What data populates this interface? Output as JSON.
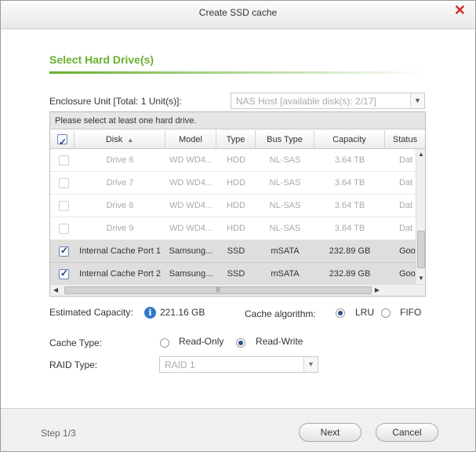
{
  "dialog": {
    "title": "Create SSD cache",
    "close_glyph": "✕"
  },
  "section": {
    "title": "Select Hard Drive(s)"
  },
  "enclosure": {
    "label": "Enclosure Unit [Total: 1 Unit(s)]:",
    "selected": "NAS Host [available disk(s): 2/17]"
  },
  "grid": {
    "info": "Please select at least one hard drive.",
    "columns": [
      "Disk",
      "Model",
      "Type",
      "Bus Type",
      "Capacity",
      "Status"
    ],
    "sort_indicator": "▲",
    "rows": [
      {
        "disk": "Drive 6",
        "model": "WD WD4...",
        "type": "HDD",
        "bus": "NL-SAS",
        "capacity": "3.64 TB",
        "status": "Dat",
        "checked": false,
        "enabled": false
      },
      {
        "disk": "Drive 7",
        "model": "WD WD4...",
        "type": "HDD",
        "bus": "NL-SAS",
        "capacity": "3.64 TB",
        "status": "Dat",
        "checked": false,
        "enabled": false
      },
      {
        "disk": "Drive 8",
        "model": "WD WD4...",
        "type": "HDD",
        "bus": "NL-SAS",
        "capacity": "3.64 TB",
        "status": "Dat",
        "checked": false,
        "enabled": false
      },
      {
        "disk": "Drive 9",
        "model": "WD WD4...",
        "type": "HDD",
        "bus": "NL-SAS",
        "capacity": "3.64 TB",
        "status": "Dat",
        "checked": false,
        "enabled": false
      },
      {
        "disk": "Internal Cache Port 1",
        "model": "Samsung...",
        "type": "SSD",
        "bus": "mSATA",
        "capacity": "232.89 GB",
        "status": "Goo",
        "checked": true,
        "enabled": true
      },
      {
        "disk": "Internal Cache Port 2",
        "model": "Samsung...",
        "type": "SSD",
        "bus": "mSATA",
        "capacity": "232.89 GB",
        "status": "Goo",
        "checked": true,
        "enabled": true
      }
    ],
    "header_checked": true
  },
  "estimated": {
    "label": "Estimated Capacity:",
    "value": "221.16 GB"
  },
  "cache_algorithm": {
    "label": "Cache algorithm:",
    "options": [
      "LRU",
      "FIFO"
    ],
    "selected": "LRU"
  },
  "cache_type": {
    "label": "Cache Type:",
    "options": [
      "Read-Only",
      "Read-Write"
    ],
    "selected": "Read-Write"
  },
  "raid": {
    "label": "RAID Type:",
    "selected": "RAID 1"
  },
  "footer": {
    "step": "Step 1/3",
    "next": "Next",
    "cancel": "Cancel"
  },
  "colors": {
    "accent_green": "#6aae2f",
    "close_red": "#d62a2a",
    "info_blue": "#2f79c6"
  }
}
